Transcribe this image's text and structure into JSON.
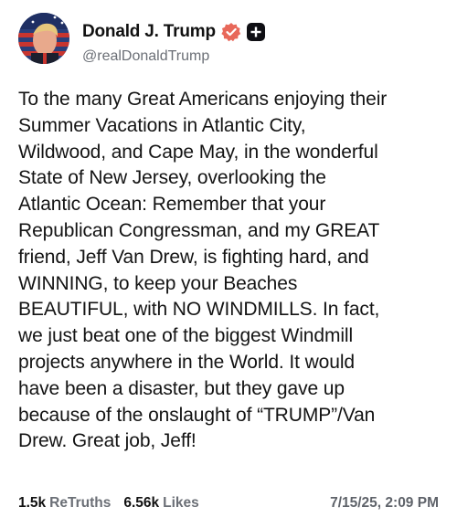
{
  "author": {
    "display_name": "Donald J. Trump",
    "handle": "@realDonaldTrump",
    "verified_icon": "verified-badge-icon",
    "plus_icon": "plus-badge-icon",
    "accent_color": "#e8685a"
  },
  "post": {
    "text": "To the many Great Americans enjoying their\nSummer Vacations in Atlantic City,\nWildwood, and Cape May, in the wonderful\nState of New Jersey, overlooking the\nAtlantic Ocean: Remember that your\nRepublican Congressman, and my GREAT\nfriend, Jeff Van Drew, is fighting hard, and\nWINNING, to keep your Beaches\nBEAUTIFUL, with NO WINDMILLS. In fact,\nwe just beat one of the biggest Windmill\nprojects anywhere in the World. It would\nhave been a disaster, but they gave up\nbecause of the onslaught of “TRUMP”/Van\nDrew. Great job, Jeff!"
  },
  "stats": {
    "retruths_count": "1.5k",
    "retruths_label": "ReTruths",
    "likes_count": "6.56k",
    "likes_label": "Likes"
  },
  "timestamp": "7/15/25, 2:09 PM"
}
